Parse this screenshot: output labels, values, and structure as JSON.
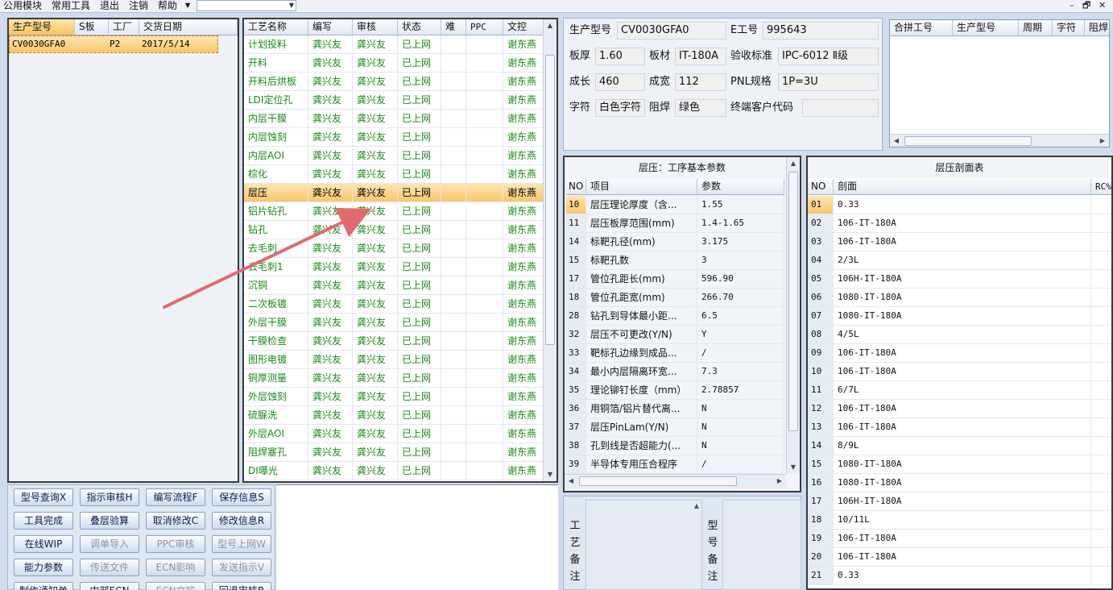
{
  "menubar": {
    "items": [
      "公用模块",
      "常用工具",
      "退出",
      "注销",
      "帮助"
    ],
    "window_controls": [
      "–",
      "🗗",
      "✕"
    ]
  },
  "model_list": {
    "headers": [
      "生产型号",
      "S板",
      "工厂",
      "交货日期"
    ],
    "rows": [
      {
        "model": "CV0030GFA0",
        "s_board": "",
        "factory": "P2",
        "delivery": "2017/5/14"
      }
    ]
  },
  "process_list": {
    "headers": [
      "工艺名称",
      "编写",
      "审核",
      "状态",
      "难",
      "PPC",
      "文控"
    ],
    "highlighted_index": 8,
    "rows": [
      [
        "计划投料",
        "龚兴友",
        "龚兴友",
        "已上网",
        "",
        "",
        "谢东燕"
      ],
      [
        "开料",
        "龚兴友",
        "龚兴友",
        "已上网",
        "",
        "",
        "谢东燕"
      ],
      [
        "开料后烘板",
        "龚兴友",
        "龚兴友",
        "已上网",
        "",
        "",
        "谢东燕"
      ],
      [
        "LDI定位孔",
        "龚兴友",
        "龚兴友",
        "已上网",
        "",
        "",
        "谢东燕"
      ],
      [
        "内层干膜",
        "龚兴友",
        "龚兴友",
        "已上网",
        "",
        "",
        "谢东燕"
      ],
      [
        "内层蚀刻",
        "龚兴友",
        "龚兴友",
        "已上网",
        "",
        "",
        "谢东燕"
      ],
      [
        "内层AOI",
        "龚兴友",
        "龚兴友",
        "已上网",
        "",
        "",
        "谢东燕"
      ],
      [
        "棕化",
        "龚兴友",
        "龚兴友",
        "已上网",
        "",
        "",
        "谢东燕"
      ],
      [
        "层压",
        "龚兴友",
        "龚兴友",
        "已上网",
        "",
        "",
        "谢东燕"
      ],
      [
        "铝片钻孔",
        "龚兴友",
        "龚兴友",
        "已上网",
        "",
        "",
        "谢东燕"
      ],
      [
        "钻孔",
        "龚兴友",
        "龚兴友",
        "已上网",
        "",
        "",
        "谢东燕"
      ],
      [
        "去毛刺",
        "龚兴友",
        "龚兴友",
        "已上网",
        "",
        "",
        "谢东燕"
      ],
      [
        "去毛刺1",
        "龚兴友",
        "龚兴友",
        "已上网",
        "",
        "",
        "谢东燕"
      ],
      [
        "沉铜",
        "龚兴友",
        "龚兴友",
        "已上网",
        "",
        "",
        "谢东燕"
      ],
      [
        "二次板镀",
        "龚兴友",
        "龚兴友",
        "已上网",
        "",
        "",
        "谢东燕"
      ],
      [
        "外层干膜",
        "龚兴友",
        "龚兴友",
        "已上网",
        "",
        "",
        "谢东燕"
      ],
      [
        "干膜检查",
        "龚兴友",
        "龚兴友",
        "已上网",
        "",
        "",
        "谢东燕"
      ],
      [
        "图形电镀",
        "龚兴友",
        "龚兴友",
        "已上网",
        "",
        "",
        "谢东燕"
      ],
      [
        "铜厚测量",
        "龚兴友",
        "龚兴友",
        "已上网",
        "",
        "",
        "谢东燕"
      ],
      [
        "外层蚀刻",
        "龚兴友",
        "龚兴友",
        "已上网",
        "",
        "",
        "谢东燕"
      ],
      [
        "硫脲洗",
        "龚兴友",
        "龚兴友",
        "已上网",
        "",
        "",
        "谢东燕"
      ],
      [
        "外层AOI",
        "龚兴友",
        "龚兴友",
        "已上网",
        "",
        "",
        "谢东燕"
      ],
      [
        "阻焊塞孔",
        "龚兴友",
        "龚兴友",
        "已上网",
        "",
        "",
        "谢东燕"
      ],
      [
        "DI曝光",
        "龚兴友",
        "龚兴友",
        "已上网",
        "",
        "",
        "谢东燕"
      ]
    ]
  },
  "buttons": [
    {
      "label": "型号查询X",
      "enabled": true
    },
    {
      "label": "指示审核H",
      "enabled": true
    },
    {
      "label": "编写流程F",
      "enabled": true
    },
    {
      "label": "保存信息S",
      "enabled": true
    },
    {
      "label": "工具完成",
      "enabled": true
    },
    {
      "label": "叠层验算",
      "enabled": true
    },
    {
      "label": "取消修改C",
      "enabled": true
    },
    {
      "label": "修改信息R",
      "enabled": true
    },
    {
      "label": "在线WIP",
      "enabled": true
    },
    {
      "label": "调单导入",
      "enabled": false
    },
    {
      "label": "PPC审核",
      "enabled": false
    },
    {
      "label": "型号上网W",
      "enabled": false
    },
    {
      "label": "能力参数",
      "enabled": true
    },
    {
      "label": "传送文件",
      "enabled": false
    },
    {
      "label": "ECN影响",
      "enabled": false
    },
    {
      "label": "发送指示V",
      "enabled": false
    },
    {
      "label": "制作通知单",
      "enabled": true
    },
    {
      "label": "内部ECN",
      "enabled": true
    },
    {
      "label": "ECN文控",
      "enabled": false
    },
    {
      "label": "回退审核B",
      "enabled": true
    }
  ],
  "info": {
    "model_label": "生产型号",
    "model_value": "CV0030GFA0",
    "eno_label": "E工号",
    "eno_value": "995643",
    "thickness_label": "板厚",
    "thickness_value": "1.60",
    "material_label": "板材",
    "material_value": "IT-180A",
    "standard_label": "验收标准",
    "standard_value": "IPC-6012 Ⅱ级",
    "length_label": "成长",
    "length_value": "460",
    "width_label": "成宽",
    "width_value": "112",
    "pnl_label": "PNL规格",
    "pnl_value": "1P=3U",
    "char_label": "字符",
    "char_value": "白色字符",
    "mask_label": "阻焊",
    "mask_value": "绿色",
    "customer_label": "终端客户代码",
    "customer_value": ""
  },
  "combine": {
    "headers": [
      "合拼工号",
      "生产型号",
      "周期",
      "字符",
      "阻焊"
    ]
  },
  "params": {
    "title": "层压：工序基本参数",
    "headers": [
      "NO",
      "项目",
      "参数"
    ],
    "rows": [
      [
        "10",
        "层压理论厚度（含...",
        "1.55"
      ],
      [
        "11",
        "层压板厚范围(mm)",
        "1.4-1.65"
      ],
      [
        "14",
        "标靶孔径(mm)",
        "3.175"
      ],
      [
        "15",
        "标靶孔数",
        "3"
      ],
      [
        "17",
        "管位孔距长(mm)",
        "596.90"
      ],
      [
        "18",
        "管位孔距宽(mm)",
        "266.70"
      ],
      [
        "28",
        "钻孔到导体最小距...",
        "6.5"
      ],
      [
        "32",
        "层压不可更改(Y/N)",
        "Y"
      ],
      [
        "33",
        "靶标孔边缘到成品...",
        "/"
      ],
      [
        "34",
        "最小内层隔离环宽...",
        "7.3"
      ],
      [
        "35",
        "理论铆钉长度（mm）",
        "2.78857"
      ],
      [
        "36",
        "用铜箔/铝片替代离...",
        "N"
      ],
      [
        "37",
        "层压PinLam(Y/N)",
        "N"
      ],
      [
        "38",
        "孔到线是否超能力(...",
        "N"
      ],
      [
        "39",
        "半导体专用压合程序",
        "/"
      ]
    ]
  },
  "section": {
    "title": "层压剖面表",
    "headers": [
      "NO",
      "剖面",
      "RC%"
    ],
    "rows": [
      [
        "01",
        "0.33"
      ],
      [
        "02",
        "106-IT-180A"
      ],
      [
        "03",
        "106-IT-180A"
      ],
      [
        "04",
        "2/3L"
      ],
      [
        "05",
        "106H-IT-180A"
      ],
      [
        "06",
        "1080-IT-180A"
      ],
      [
        "07",
        "1080-IT-180A"
      ],
      [
        "08",
        "4/5L"
      ],
      [
        "09",
        "106-IT-180A"
      ],
      [
        "10",
        "106-IT-180A"
      ],
      [
        "11",
        "6/7L"
      ],
      [
        "12",
        "106-IT-180A"
      ],
      [
        "13",
        "106-IT-180A"
      ],
      [
        "14",
        "8/9L"
      ],
      [
        "15",
        "1080-IT-180A"
      ],
      [
        "16",
        "1080-IT-180A"
      ],
      [
        "17",
        "106H-IT-180A"
      ],
      [
        "18",
        "10/11L"
      ],
      [
        "19",
        "106-IT-180A"
      ],
      [
        "20",
        "106-IT-180A"
      ],
      [
        "21",
        "0.33"
      ]
    ]
  },
  "remarks": {
    "process_label": "工艺备注",
    "model_label": "型号备注"
  }
}
